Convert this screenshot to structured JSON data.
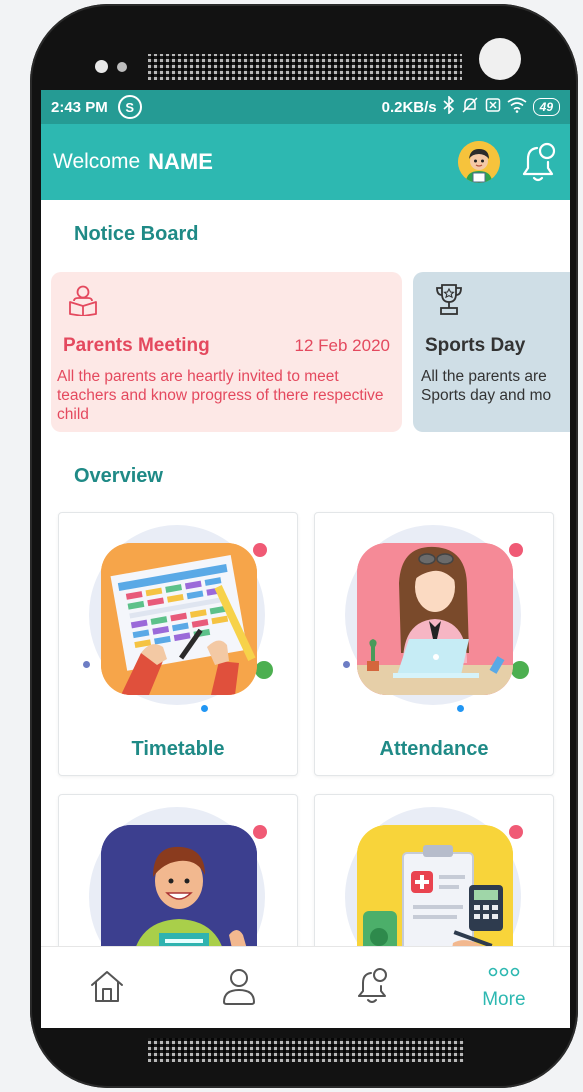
{
  "status_bar": {
    "time": "2:43 PM",
    "network_speed": "0.2KB/s",
    "battery": "49",
    "icons": [
      "skype-icon",
      "bluetooth-icon",
      "mute-icon",
      "sim-icon",
      "wifi-icon",
      "battery-icon"
    ]
  },
  "header": {
    "welcome": "Welcome",
    "name": "NAME",
    "avatar_icon": "avatar-icon",
    "notification_icon": "bell-icon"
  },
  "notice_board": {
    "title": "Notice Board",
    "cards": [
      {
        "icon": "reading-icon",
        "title": "Parents Meeting",
        "date": "12 Feb 2020",
        "text": "All the parents are heartly invited to meet teachers and know progress of there respective child",
        "bg": "#fde8e6",
        "accent": "#e4495e"
      },
      {
        "icon": "trophy-icon",
        "title": "Sports Day",
        "text_line1": "All the parents are",
        "text_line2": "Sports day and mo",
        "bg": "#cfdee6",
        "accent": "#333333"
      }
    ]
  },
  "overview": {
    "title": "Overview",
    "tiles": [
      {
        "label": "Timetable"
      },
      {
        "label": "Attendance"
      },
      {
        "label": ""
      },
      {
        "label": ""
      }
    ]
  },
  "bottom_nav": {
    "items": [
      {
        "icon": "home-icon"
      },
      {
        "icon": "profile-icon"
      },
      {
        "icon": "bell-icon"
      },
      {
        "icon": "more-icon",
        "label": "More"
      }
    ]
  },
  "colors": {
    "primary": "#2db8b1",
    "status_bar": "#259b94",
    "heading": "#1f8a86"
  }
}
